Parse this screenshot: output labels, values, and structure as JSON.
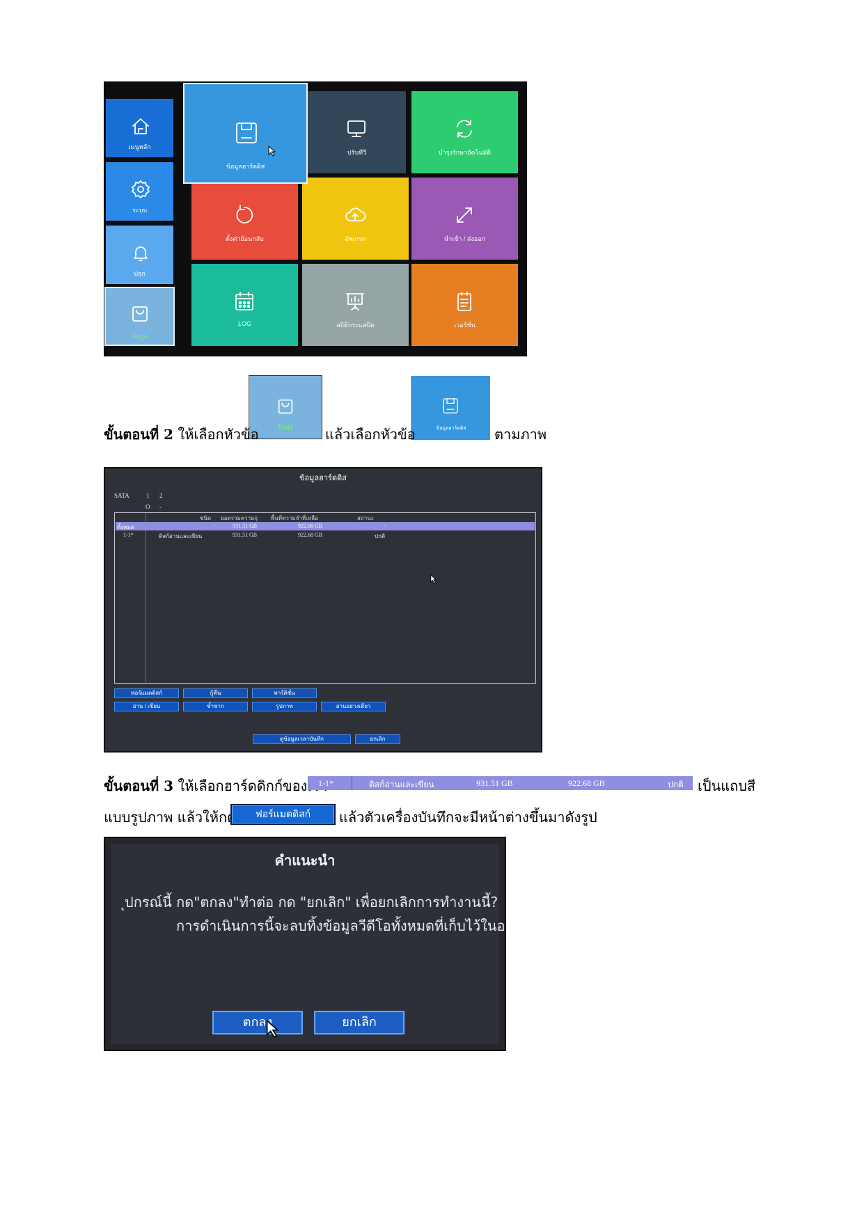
{
  "screen1": {
    "sidebar": [
      {
        "label": "เมนูหลัก",
        "icon": "home-icon",
        "color": "#1a6fd6"
      },
      {
        "label": "ระบบ",
        "icon": "gear-icon",
        "color": "#2b8ae8"
      },
      {
        "label": "ปลุก",
        "icon": "bell-icon",
        "color": "#5aa9ef"
      },
      {
        "label": "ข้อมูล",
        "icon": "shopping-bag-icon",
        "color": "#79b3de"
      }
    ],
    "tiles": [
      {
        "label": "ข้อมูลฮาร์ดดิส",
        "icon": "save-disk-icon",
        "color": "#3697de"
      },
      {
        "label": "ปรับทีวี",
        "icon": "monitor-icon",
        "color": "#33475a"
      },
      {
        "label": "บำรุงรักษาอัตโนมัติ",
        "icon": "refresh-icon",
        "color": "#2ecc71"
      },
      {
        "label": "ตั้งค่าย้อนกลับ",
        "icon": "undo-icon",
        "color": "#e74c3c"
      },
      {
        "label": "อัพเกรด",
        "icon": "cloud-upload-icon",
        "color": "#f1c40f"
      },
      {
        "label": "นำเข้า / ส่งออก",
        "icon": "expand-icon",
        "color": "#9b59b6"
      },
      {
        "label": "LOG",
        "icon": "calendar-icon",
        "color": "#1abc9c"
      },
      {
        "label": "สถิติกระแสบิต",
        "icon": "presentation-icon",
        "color": "#95a5a6"
      },
      {
        "label": "เวอร์ชั่น",
        "icon": "notes-icon",
        "color": "#e67e22"
      }
    ]
  },
  "step2": {
    "bold": "ขั้นตอนที่ 2",
    "text_a": "ให้เลือกหัวข้อ",
    "text_b": "แล้วเลือกหัวข้อ",
    "text_c": "ตามภาพ",
    "thumb1_label": "ข้อมูล",
    "thumb2_label": "ข้อมูลฮาร์ดดิส"
  },
  "screen2": {
    "title": "ข้อมูลฮาร์ดดิส",
    "sata_label": "SATA",
    "sata_ports": [
      "1",
      "2"
    ],
    "sata_status": [
      "O",
      "-"
    ],
    "columns": [
      "ชนิด",
      "ยอดรวมความจุ",
      "พื้นที่ความจำที่เหลือ",
      "สถานะ"
    ],
    "rows": [
      {
        "id": "ทั้งหมด",
        "type": "",
        "total": "931.51 GB",
        "free": "922.68 GB",
        "status": "-",
        "selected": true
      },
      {
        "id": "1-1*",
        "type": "ดิสก์อ่านและเขียน",
        "total": "931.51 GB",
        "free": "922.68 GB",
        "status": "ปกติ",
        "selected": false
      }
    ],
    "buttons_row1": [
      "ฟอร์แมตดิสก์",
      "กู้คืน",
      "พาร์ติชั่น"
    ],
    "buttons_row2": [
      "อ่าน / เขียน",
      "ซ้ำซาก",
      "รูปภาพ",
      "อ่านอย่างเดียว"
    ],
    "bottom_buttons": [
      "ดูข้อมูลเวลาบันทึก",
      "ยกเลิก"
    ]
  },
  "step3": {
    "bold": "ขั้นตอนที่ 3",
    "text_a": "ให้เลือกฮาร์ดดิกก์ของเรา",
    "text_b": "เป็นแถบสี",
    "line2_a": "แบบรูปภาพ แล้วให้กด",
    "line2_b": "แล้วตัวเครื่องบันทึกจะมีหน้าต่างขึ้นมาดังรูป",
    "strip": {
      "id": "1-1*",
      "type": "ดิสก์อ่านและเขียน",
      "total": "931.51 GB",
      "free": "922.68 GB",
      "status": "ปกติ"
    },
    "format_button": "ฟอร์แมตดิสก์"
  },
  "screen3": {
    "title": "คำแนะนำ",
    "line1": "ุปกรณ์นี้ กด\"ตกลง\"ทำต่อ กด \"ยกเลิก\" เพื่อยกเลิกการทำงานนี้?",
    "line2": "การดำเนินการนี้จะลบทิ้งข้อมูลวีดีโอทั้งหมดที่เก็บไว้ในอ",
    "ok": "ตกลง",
    "cancel": "ยกเลิก"
  }
}
